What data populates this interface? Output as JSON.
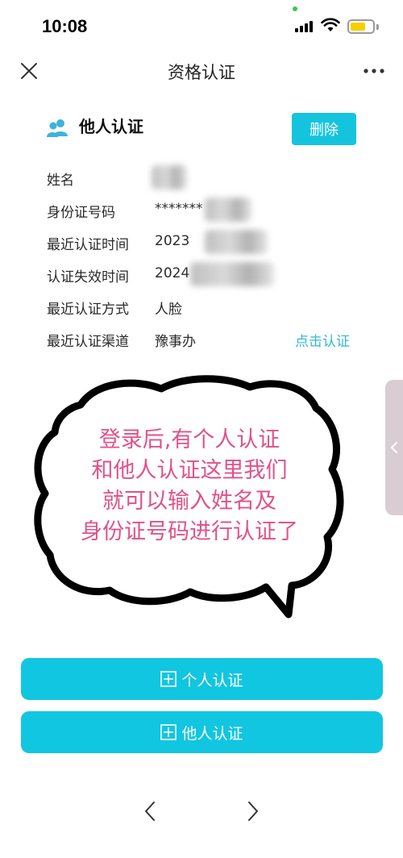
{
  "status_bar": {
    "time": "10:08"
  },
  "nav": {
    "title": "资格认证"
  },
  "card": {
    "title": "他人认证",
    "delete_label": "删除",
    "rows": [
      {
        "label": "姓名",
        "value": ""
      },
      {
        "label": "身份证号码",
        "value": "*******"
      },
      {
        "label": "最近认证时间",
        "value": "2023"
      },
      {
        "label": "认证失效时间",
        "value": "2024"
      },
      {
        "label": "最近认证方式",
        "value": "人脸"
      },
      {
        "label": "最近认证渠道",
        "value": "豫事办",
        "action": "点击认证"
      }
    ]
  },
  "annotation": {
    "lines": [
      "登录后,有个人认证",
      "和他人认证这里我们",
      "就可以输入姓名及",
      "身份证号码进行认证了"
    ]
  },
  "buttons": {
    "personal": "个人认证",
    "others": "他人认证"
  },
  "colors": {
    "accent": "#14c4de",
    "link": "#34b8d6",
    "annotation_text": "#e0528a"
  },
  "icons": {
    "close": "close-icon",
    "more": "more-icon",
    "user_group": "user-group-icon",
    "plus_box": "plus-box-icon",
    "back": "chevron-left-icon",
    "forward": "chevron-right-icon"
  }
}
